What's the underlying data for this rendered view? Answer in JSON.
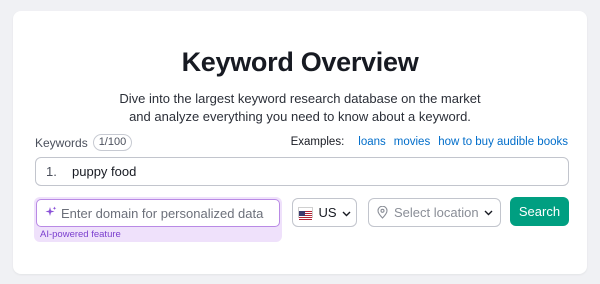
{
  "page": {
    "title": "Keyword Overview",
    "subtitle_line1": "Dive into the largest keyword research database on the market",
    "subtitle_line2": "and analyze everything you need to know about a keyword."
  },
  "keywords": {
    "label": "Keywords",
    "count": "1/100",
    "line_number": "1.",
    "value": "puppy food"
  },
  "examples": {
    "label": "Examples:",
    "links": [
      "loans",
      "movies",
      "how to buy audible books"
    ]
  },
  "domain": {
    "placeholder": "Enter domain for personalized data",
    "ai_note": "AI-powered feature"
  },
  "country": {
    "code": "US",
    "icon": "us-flag-icon"
  },
  "location": {
    "placeholder": "Select location",
    "icon": "location-pin-icon"
  },
  "search": {
    "label": "Search"
  },
  "colors": {
    "accent": "#009f81",
    "link": "#006dca",
    "ai_purple": "#7b3fce",
    "ai_bg": "#efe1fb"
  }
}
